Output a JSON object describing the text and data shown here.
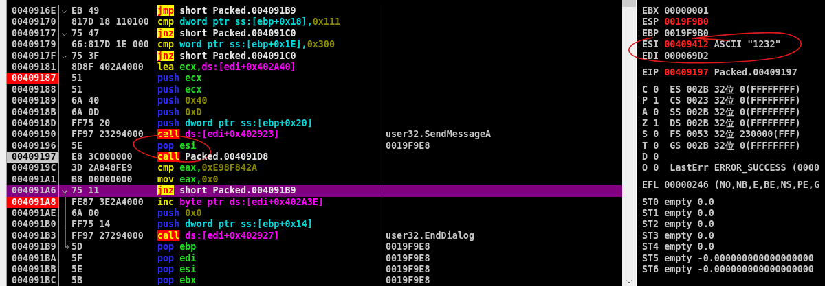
{
  "disassembly": {
    "rows": [
      {
        "address": "0040916E",
        "breakpoint": false,
        "eip": false,
        "jump_mark": true,
        "hex": "EB 49",
        "mnemonic": {
          "text": "jmp",
          "kind": "jump"
        },
        "operands": [
          {
            "text": "short Packed.004091B9",
            "kind": "label"
          }
        ],
        "selected": false,
        "circled": false
      },
      {
        "address": "00409170",
        "breakpoint": false,
        "eip": false,
        "jump_mark": false,
        "hex": "817D 18 110100",
        "mnemonic": {
          "text": "cmp",
          "kind": "plain"
        },
        "operands": [
          {
            "text": "dword ptr ss:[ebp+0x18],",
            "kind": "mem_ss"
          },
          {
            "text": "0x111",
            "kind": "const"
          }
        ],
        "selected": false,
        "circled": false
      },
      {
        "address": "00409177",
        "breakpoint": false,
        "eip": false,
        "jump_mark": true,
        "hex": "75 47",
        "mnemonic": {
          "text": "jnz",
          "kind": "jump"
        },
        "operands": [
          {
            "text": "short Packed.004091C0",
            "kind": "label"
          }
        ],
        "selected": false,
        "circled": false
      },
      {
        "address": "00409179",
        "breakpoint": false,
        "eip": false,
        "jump_mark": false,
        "hex": "66:817D 1E 000",
        "mnemonic": {
          "text": "cmp",
          "kind": "plain"
        },
        "operands": [
          {
            "text": "word ptr ss:[ebp+0x1E],",
            "kind": "mem_ss"
          },
          {
            "text": "0x300",
            "kind": "const"
          }
        ],
        "selected": false,
        "circled": false
      },
      {
        "address": "0040917F",
        "breakpoint": false,
        "eip": false,
        "jump_mark": true,
        "hex": "75 3F",
        "mnemonic": {
          "text": "jnz",
          "kind": "jump"
        },
        "operands": [
          {
            "text": "short Packed.004091C0",
            "kind": "label"
          }
        ],
        "selected": false,
        "circled": false
      },
      {
        "address": "00409181",
        "breakpoint": false,
        "eip": false,
        "jump_mark": false,
        "hex": "8D8F 402A4000",
        "mnemonic": {
          "text": "lea",
          "kind": "plain"
        },
        "operands": [
          {
            "text": "ecx,",
            "kind": "reg"
          },
          {
            "text": "ds:[edi+0x402A40]",
            "kind": "mem_ds"
          }
        ],
        "selected": false,
        "circled": false
      },
      {
        "address": "00409187",
        "breakpoint": true,
        "eip": false,
        "jump_mark": false,
        "hex": "51",
        "mnemonic": {
          "text": "push",
          "kind": "stack"
        },
        "operands": [
          {
            "text": "ecx",
            "kind": "reg"
          }
        ],
        "selected": false,
        "circled": false
      },
      {
        "address": "00409188",
        "breakpoint": false,
        "eip": false,
        "jump_mark": false,
        "hex": "51",
        "mnemonic": {
          "text": "push",
          "kind": "stack"
        },
        "operands": [
          {
            "text": "ecx",
            "kind": "reg"
          }
        ],
        "selected": false,
        "circled": false
      },
      {
        "address": "00409189",
        "breakpoint": false,
        "eip": false,
        "jump_mark": false,
        "hex": "6A 40",
        "mnemonic": {
          "text": "push",
          "kind": "stack"
        },
        "operands": [
          {
            "text": "0x40",
            "kind": "const"
          }
        ],
        "selected": false,
        "circled": false
      },
      {
        "address": "0040918B",
        "breakpoint": false,
        "eip": false,
        "jump_mark": false,
        "hex": "6A 0D",
        "mnemonic": {
          "text": "push",
          "kind": "stack"
        },
        "operands": [
          {
            "text": "0xD",
            "kind": "const"
          }
        ],
        "selected": false,
        "circled": false
      },
      {
        "address": "0040918D",
        "breakpoint": false,
        "eip": false,
        "jump_mark": false,
        "hex": "FF75 20",
        "mnemonic": {
          "text": "push",
          "kind": "stack"
        },
        "operands": [
          {
            "text": "dword ptr ss:[ebp+0x20]",
            "kind": "mem_ss"
          }
        ],
        "selected": false,
        "circled": false
      },
      {
        "address": "00409190",
        "breakpoint": false,
        "eip": false,
        "jump_mark": false,
        "hex": "FF97 23294000",
        "mnemonic": {
          "text": "call",
          "kind": "call"
        },
        "operands": [
          {
            "text": "ds:[edi+0x402923]",
            "kind": "mem_ds"
          }
        ],
        "comment": "user32.SendMessageA",
        "selected": false,
        "circled": false
      },
      {
        "address": "00409196",
        "breakpoint": false,
        "eip": false,
        "jump_mark": false,
        "hex": "5E",
        "mnemonic": {
          "text": "pop",
          "kind": "stack"
        },
        "operands": [
          {
            "text": "esi",
            "kind": "reg"
          }
        ],
        "comment": "0019F9E8",
        "selected": false,
        "circled": true
      },
      {
        "address": "00409197",
        "breakpoint": false,
        "eip": true,
        "jump_mark": false,
        "hex": "E8 3C000000",
        "mnemonic": {
          "text": "call",
          "kind": "call"
        },
        "operands": [
          {
            "text": "Packed.004091D8",
            "kind": "label"
          }
        ],
        "selected": false,
        "circled": false
      },
      {
        "address": "0040919C",
        "breakpoint": false,
        "eip": false,
        "jump_mark": false,
        "hex": "3D 2A848FE9",
        "mnemonic": {
          "text": "cmp",
          "kind": "plain"
        },
        "operands": [
          {
            "text": "eax,",
            "kind": "reg"
          },
          {
            "text": "0xE98F842A",
            "kind": "const"
          }
        ],
        "selected": false,
        "circled": false
      },
      {
        "address": "004091A1",
        "breakpoint": false,
        "eip": false,
        "jump_mark": false,
        "hex": "B8 00000000",
        "mnemonic": {
          "text": "mov",
          "kind": "plain"
        },
        "operands": [
          {
            "text": "eax,",
            "kind": "reg"
          },
          {
            "text": "0x0",
            "kind": "const"
          }
        ],
        "selected": false,
        "circled": false
      },
      {
        "address": "004091A6",
        "breakpoint": false,
        "eip": false,
        "jump_mark": true,
        "jump_line": {
          "kind": "start"
        },
        "hex": "75 11",
        "mnemonic": {
          "text": "jnz",
          "kind": "jump"
        },
        "operands": [
          {
            "text": "short Packed.004091B9",
            "kind": "label"
          }
        ],
        "selected": true,
        "circled": false
      },
      {
        "address": "004091A8",
        "breakpoint": true,
        "eip": false,
        "jump_mark": false,
        "jump_line": {
          "kind": "through"
        },
        "hex": "FE87 3E2A4000",
        "mnemonic": {
          "text": "inc",
          "kind": "plain"
        },
        "operands": [
          {
            "text": "byte ptr ds:[edi+0x402A3E]",
            "kind": "mem_ds"
          }
        ],
        "selected": false,
        "circled": false
      },
      {
        "address": "004091AE",
        "breakpoint": false,
        "eip": false,
        "jump_mark": false,
        "jump_line": {
          "kind": "through"
        },
        "hex": "6A 00",
        "mnemonic": {
          "text": "push",
          "kind": "stack"
        },
        "operands": [
          {
            "text": "0x0",
            "kind": "const"
          }
        ],
        "selected": false,
        "circled": false
      },
      {
        "address": "004091B0",
        "breakpoint": false,
        "eip": false,
        "jump_mark": false,
        "jump_line": {
          "kind": "through"
        },
        "hex": "FF75 14",
        "mnemonic": {
          "text": "push",
          "kind": "stack"
        },
        "operands": [
          {
            "text": "dword ptr ss:[ebp+0x14]",
            "kind": "mem_ss"
          }
        ],
        "selected": false,
        "circled": false
      },
      {
        "address": "004091B3",
        "breakpoint": false,
        "eip": false,
        "jump_mark": false,
        "jump_line": {
          "kind": "through"
        },
        "hex": "FF97 27294000",
        "mnemonic": {
          "text": "call",
          "kind": "call"
        },
        "operands": [
          {
            "text": "ds:[edi+0x402927]",
            "kind": "mem_ds"
          }
        ],
        "comment": "user32.EndDialog",
        "selected": false,
        "circled": false
      },
      {
        "address": "004091B9",
        "breakpoint": false,
        "eip": false,
        "jump_mark": false,
        "jump_line": {
          "kind": "end"
        },
        "hex": "5D",
        "mnemonic": {
          "text": "pop",
          "kind": "stack"
        },
        "operands": [
          {
            "text": "ebp",
            "kind": "reg"
          }
        ],
        "comment": "0019F9E8",
        "selected": false,
        "circled": false
      },
      {
        "address": "004091BA",
        "breakpoint": false,
        "eip": false,
        "jump_mark": false,
        "hex": "5F",
        "mnemonic": {
          "text": "pop",
          "kind": "stack"
        },
        "operands": [
          {
            "text": "edi",
            "kind": "reg"
          }
        ],
        "comment": "0019F9E8",
        "selected": false,
        "circled": false
      },
      {
        "address": "004091BB",
        "breakpoint": false,
        "eip": false,
        "jump_mark": false,
        "hex": "5E",
        "mnemonic": {
          "text": "pop",
          "kind": "stack"
        },
        "operands": [
          {
            "text": "esi",
            "kind": "reg"
          }
        ],
        "comment": "0019F9E8",
        "selected": false,
        "circled": false
      },
      {
        "address": "004091BC",
        "breakpoint": false,
        "eip": false,
        "jump_mark": false,
        "hex": "5B",
        "mnemonic": {
          "text": "pop",
          "kind": "stack"
        },
        "operands": [
          {
            "text": "ebx",
            "kind": "reg"
          }
        ],
        "comment": "0019F9E8",
        "selected": false,
        "circled": false
      }
    ]
  },
  "register_groups": [
    {
      "rows": [
        {
          "kind": "reg",
          "name": "EBX",
          "value": "00000001",
          "changed": false,
          "circled": false
        },
        {
          "kind": "reg",
          "name": "ESP",
          "value": "0019F9B0",
          "changed": true,
          "circled": false
        },
        {
          "kind": "reg",
          "name": "EBP",
          "value": "0019F9B0",
          "changed": false,
          "circled": false
        },
        {
          "kind": "reg",
          "name": "ESI",
          "value": "00409412",
          "changed": true,
          "comment": "ASCII \"1232\"",
          "circled": true
        },
        {
          "kind": "reg",
          "name": "EDI",
          "value": "000069D2",
          "changed": false,
          "circled": false
        }
      ]
    },
    {
      "rows": [
        {
          "kind": "reg",
          "name": "EIP",
          "value": "00409197",
          "changed": true,
          "comment": "Packed.00409197",
          "circled": false
        }
      ]
    },
    {
      "rows": [
        {
          "kind": "flag",
          "name": "C",
          "value": "0",
          "detail": "ES 002B 32位 0(FFFFFFFF)"
        },
        {
          "kind": "flag",
          "name": "P",
          "value": "1",
          "detail": "CS 0023 32位 0(FFFFFFFF)"
        },
        {
          "kind": "flag",
          "name": "A",
          "value": "0",
          "detail": "SS 002B 32位 0(FFFFFFFF)"
        },
        {
          "kind": "flag",
          "name": "Z",
          "value": "1",
          "detail": "DS 002B 32位 0(FFFFFFFF)"
        },
        {
          "kind": "flag",
          "name": "S",
          "value": "0",
          "detail": "FS 0053 32位 230000(FFF)"
        },
        {
          "kind": "flag",
          "name": "T",
          "value": "0",
          "detail": "GS 002B 32位 0(FFFFFFFF)"
        },
        {
          "kind": "flag",
          "name": "D",
          "value": "0"
        },
        {
          "kind": "flag",
          "name": "O",
          "value": "0",
          "detail": "LastErr ERROR_SUCCESS (0000"
        }
      ]
    },
    {
      "rows": [
        {
          "kind": "reg",
          "name": "EFL",
          "value": "00000246",
          "changed": false,
          "comment": "(NO,NB,E,BE,NS,PE,G",
          "circled": false
        }
      ]
    },
    {
      "rows": [
        {
          "kind": "fpu",
          "name": "ST0",
          "value": "empty 0.0"
        },
        {
          "kind": "fpu",
          "name": "ST1",
          "value": "empty 0.0"
        },
        {
          "kind": "fpu",
          "name": "ST2",
          "value": "empty 0.0"
        },
        {
          "kind": "fpu",
          "name": "ST3",
          "value": "empty 0.0"
        },
        {
          "kind": "fpu",
          "name": "ST4",
          "value": "empty 0.0"
        },
        {
          "kind": "fpu",
          "name": "ST5",
          "value": "empty -0.000000000000000000"
        },
        {
          "kind": "fpu",
          "name": "ST6",
          "value": "empty -0.000000000000000000"
        }
      ]
    }
  ]
}
